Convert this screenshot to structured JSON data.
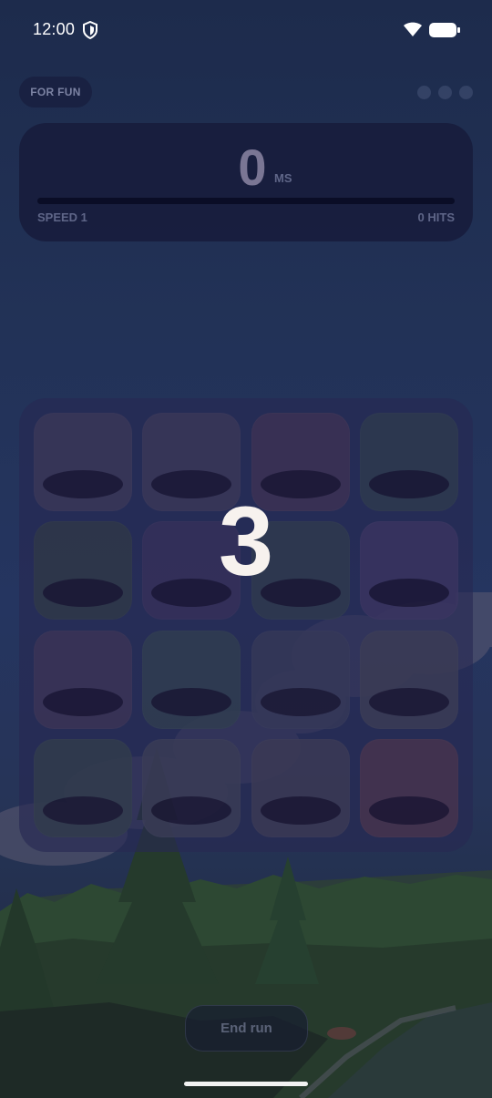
{
  "status_bar": {
    "time": "12:00",
    "icons": [
      "shield-icon",
      "wifi-icon",
      "battery-icon"
    ]
  },
  "header": {
    "mode_label": "FOR FUN",
    "menu_dots": 3
  },
  "score": {
    "value": "0",
    "unit": "MS",
    "speed_label": "SPEED 1",
    "hits_label": "0 HITS",
    "progress": 0
  },
  "board": {
    "rows": 4,
    "cols": 4,
    "tile_colors": [
      "#3a3758",
      "#3a3758",
      "#3d3254",
      "#2e3a4e",
      "#2f3848",
      "#36305a",
      "#2f3a4e",
      "#3a3460",
      "#3b3456",
      "#303d50",
      "#353858",
      "#3b3c55",
      "#313c4c",
      "#3a3c56",
      "#3b3a55",
      "#48344e"
    ]
  },
  "countdown": "3",
  "footer": {
    "end_run_label": "End run"
  }
}
